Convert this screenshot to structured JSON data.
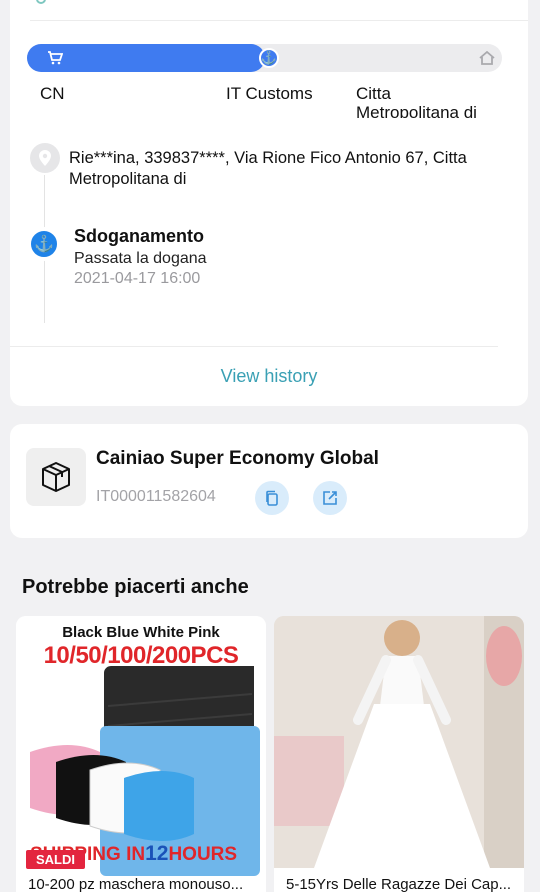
{
  "tracking": {
    "stages": [
      "CN",
      "IT Customs",
      "Citta Metropolitana di"
    ],
    "progress_percent": 50,
    "address": "Rie***ina,  339837****,  Via Rione Fico Antonio 67,  Citta Metropolitana di",
    "latest_event": {
      "title": "Sdoganamento",
      "description": "Passata la dogana",
      "time": "2021-04-17 16:00"
    },
    "view_history_label": "View history"
  },
  "carrier": {
    "name": "Cainiao Super Economy Global",
    "tracking_number": "IT000011582604"
  },
  "recommendations": {
    "title": "Potrebbe piacerti anche",
    "products": [
      {
        "name": "10-200 pz maschera monouso...",
        "image_text_top": "Black Blue White Pink",
        "image_text_big": "10/50/100/200PCS",
        "image_text_bottom_prefix": "SHIPPING IN",
        "image_text_bottom_number": "12",
        "image_text_bottom_suffix": "HOURS",
        "badge": "SALDI"
      },
      {
        "name": "5-15Yrs Delle Ragazze Dei Cap..."
      }
    ]
  },
  "colors": {
    "accent_blue": "#3f7bf0",
    "link_teal": "#3aa0b4",
    "sale_red": "#e3253f"
  }
}
